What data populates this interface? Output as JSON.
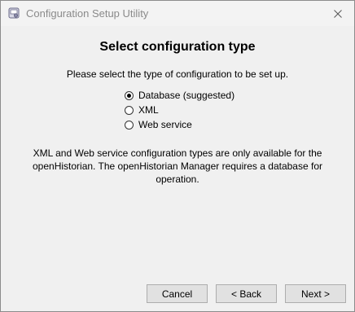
{
  "window": {
    "title": "Configuration Setup Utility",
    "app_icon": "setup-utility-icon",
    "close_icon": "close-icon"
  },
  "page": {
    "heading": "Select configuration type",
    "prompt": "Please select the type of configuration to be set up.",
    "options": [
      {
        "label": "Database (suggested)",
        "checked": true
      },
      {
        "label": "XML",
        "checked": false
      },
      {
        "label": "Web service",
        "checked": false
      }
    ],
    "note_lines": [
      "XML and Web service configuration types are only available for the",
      "openHistorian. The openHistorian Manager requires a database for",
      "operation."
    ]
  },
  "buttons": {
    "cancel": "Cancel",
    "back": "< Back",
    "next": "Next >"
  }
}
